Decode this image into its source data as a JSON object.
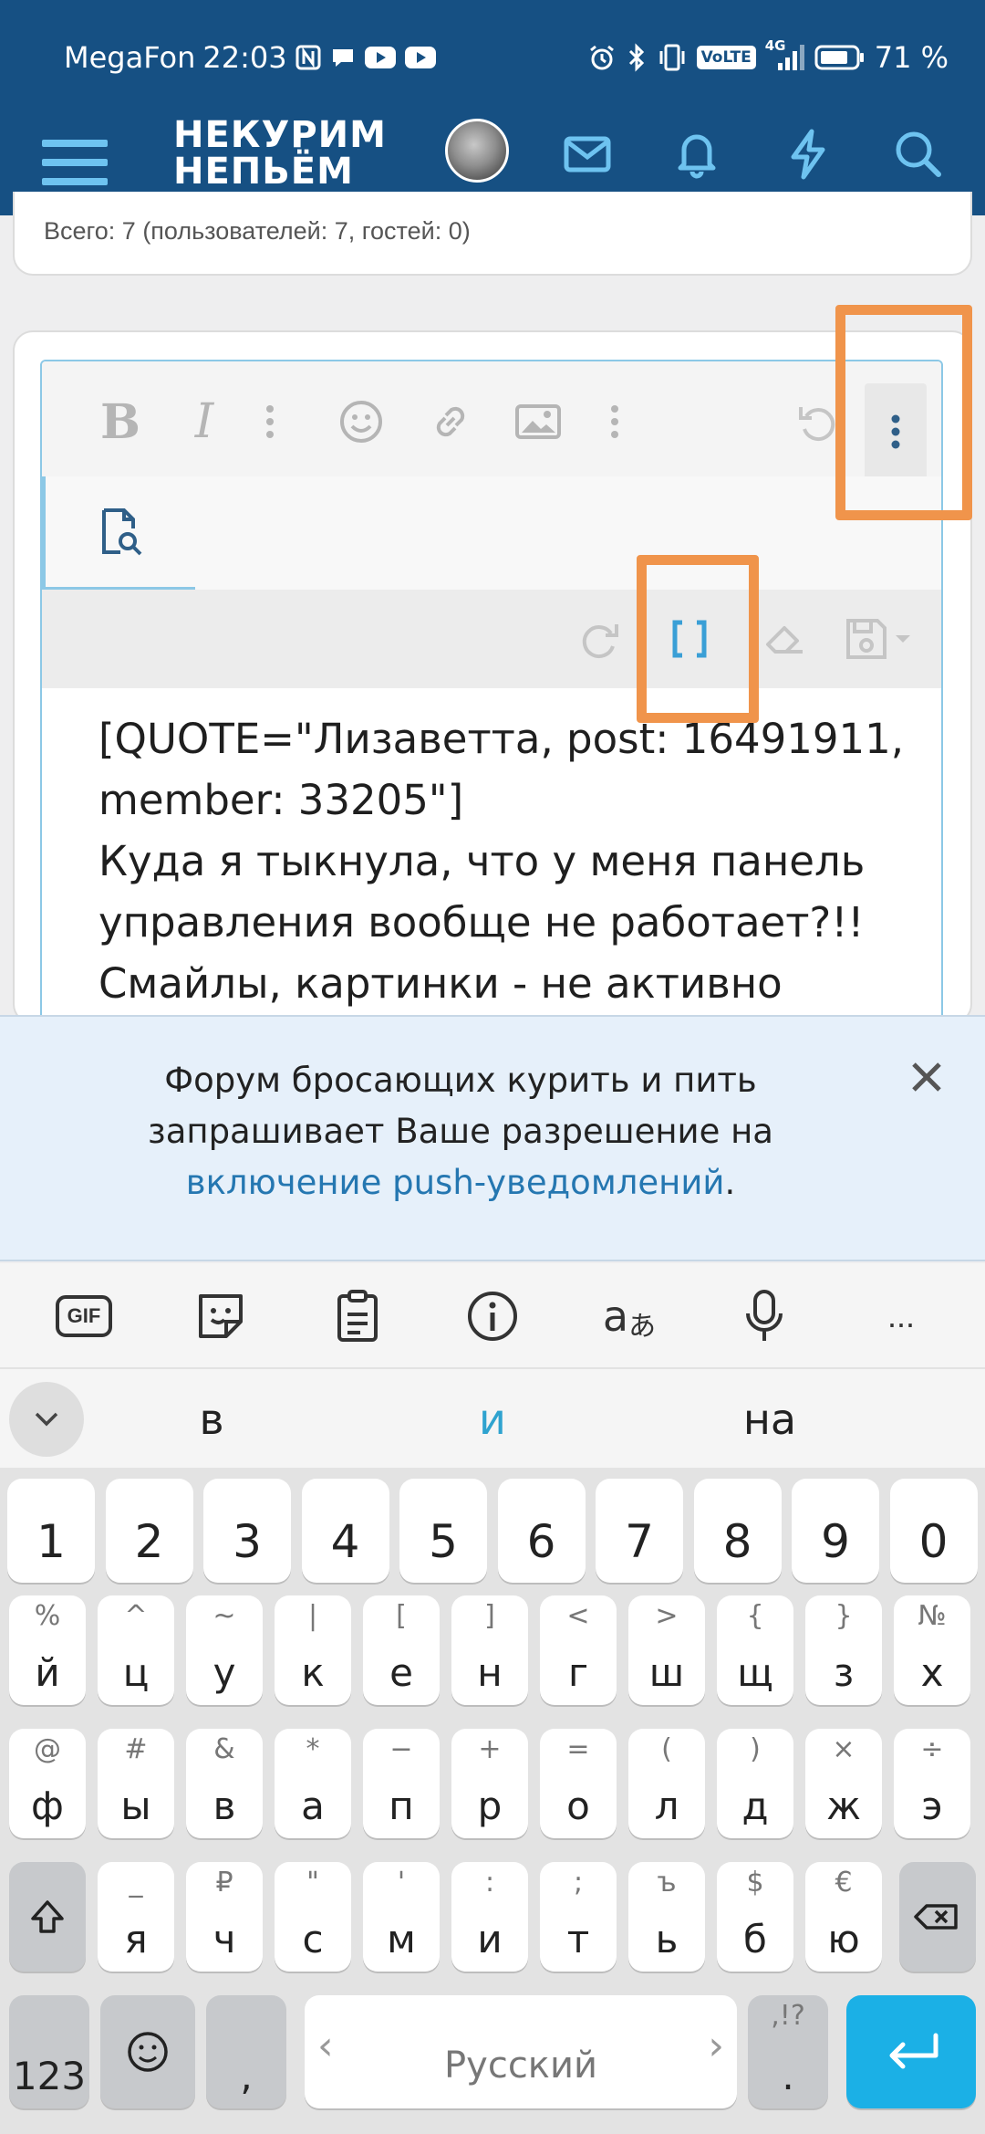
{
  "status_bar": {
    "carrier": "MegaFon",
    "time": "22:03",
    "volte": "VoLTE",
    "network": "4G",
    "battery_percent": "71 %"
  },
  "app_bar": {
    "logo_line1": "НЕКУРИМ",
    "logo_line2": "НЕПЬЁМ"
  },
  "online_summary": "Всего: 7 (пользователей: 7, гостей: 0)",
  "editor": {
    "content_lines": [
      "[QUOTE=\"Лизаветта, post: 16491911,",
      "member: 33205\"]",
      "Куда я тыкнула, что у меня панель",
      "управления вообще не работает?!!",
      "Смайлы, картинки - не активно"
    ]
  },
  "push_notice": {
    "text_before": "Форум бросающих курить и пить запрашивает Ваше разрешение на ",
    "link_text": "включение push-уведомлений",
    "text_after": "."
  },
  "keyboard_toolbar": {
    "gif_label": "GIF",
    "more": "..."
  },
  "suggestions": [
    "в",
    "и",
    "на"
  ],
  "suggestion_highlight_color": "#2fa3cf",
  "keyboard": {
    "numbers": [
      "1",
      "2",
      "3",
      "4",
      "5",
      "6",
      "7",
      "8",
      "9",
      "0"
    ],
    "row1": [
      [
        "%",
        "й"
      ],
      [
        "^",
        "ц"
      ],
      [
        "~",
        "у"
      ],
      [
        "|",
        "к"
      ],
      [
        "[",
        "е"
      ],
      [
        "]",
        "н"
      ],
      [
        "<",
        "г"
      ],
      [
        ">",
        "ш"
      ],
      [
        "{",
        "щ"
      ],
      [
        "}",
        "з"
      ],
      [
        "№",
        "х"
      ]
    ],
    "row2": [
      [
        "@",
        "ф"
      ],
      [
        "#",
        "ы"
      ],
      [
        "&",
        "в"
      ],
      [
        "*",
        "а"
      ],
      [
        "−",
        "п"
      ],
      [
        "+",
        "р"
      ],
      [
        "=",
        "о"
      ],
      [
        "(",
        "л"
      ],
      [
        ")",
        "д"
      ],
      [
        "×",
        "ж"
      ],
      [
        "÷",
        "э"
      ]
    ],
    "row3": [
      [
        "_",
        "я"
      ],
      [
        "₽",
        "ч"
      ],
      [
        "\"",
        "с"
      ],
      [
        "'",
        "м"
      ],
      [
        ":",
        "и"
      ],
      [
        ";",
        "т"
      ],
      [
        "ъ",
        "ь"
      ],
      [
        "$",
        "б"
      ],
      [
        "€",
        "ю"
      ]
    ],
    "sym_key": "123",
    "comma": ",",
    "space_label": "Русский",
    "period_alt": ",!?",
    "period": "."
  },
  "colors": {
    "brand": "#165083",
    "accent": "#6ec3f0",
    "highlight": "#f0944b",
    "enter": "#1bb0e6"
  }
}
